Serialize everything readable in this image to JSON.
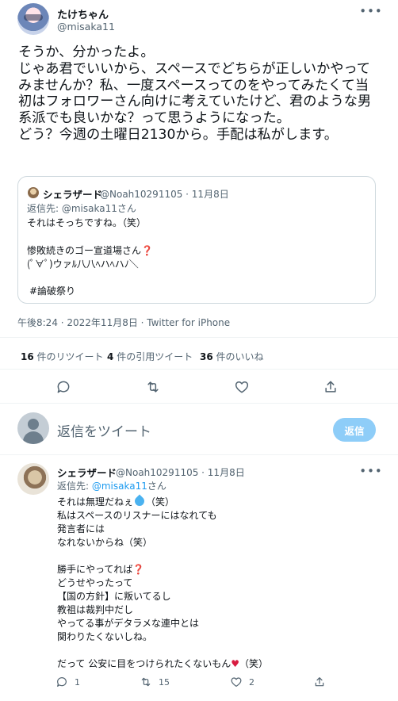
{
  "tweet": {
    "author_name": "たけちゃん",
    "author_handle": "@misaka11",
    "text": "そうか、分かったよ。\nじゃあ君でいいから、スペースでどちらが正しいかやってみませんか？私、一度スペースってのをやってみたくて当初はフォロワーさん向けに考えていたけど、君のような男系派でも良いかな？って思うようになった。\nどう？今週の土曜日2130から。手配は私がします。",
    "timestamp": "午後8:24 · 2022年11月8日 · Twitter for iPhone",
    "stats": {
      "retweets": "16",
      "retweets_label": "件のリツイート",
      "quotes": "4",
      "quotes_label": "件の引用ツイート",
      "likes": "36",
      "likes_label": "件のいいね"
    }
  },
  "quote": {
    "author_name": "シェラザード",
    "meta": "@Noah10291105 · 11月8日",
    "reply_to": "返信先: @misaka11さん",
    "line1": "それはそっちですね。（笑）",
    "line2_text": "惨敗続きのゴー宣道場さん",
    "line2_emoji": "❓",
    "line3": "(ﾟ∀ﾟ)ウァﾙ八八ﾍハﾍハﾉ＼",
    "hashtag": "#論破祭り"
  },
  "reply_box": {
    "placeholder": "返信をツイート",
    "button_label": "返信"
  },
  "reply": {
    "author_name": "シェラザード",
    "meta": "@Noah10291105 · 11月8日",
    "reply_to_prefix": "返信先: ",
    "reply_to_mention": "@misaka11",
    "reply_to_suffix": "さん",
    "line1a": "それは無理だねぇ",
    "line1b": "（笑）",
    "line2": "私はスペースのリスナーにはなれても",
    "line3": "発言者には",
    "line4": "なれないからね（笑）",
    "line5a": "勝手にやってれば",
    "line5_emoji": "❓",
    "line6": "どうせやったって",
    "line7": "【国の方針】に叛いてるし",
    "line8": "教祖は裁判中だし",
    "line9": "やってる事がデタラメな連中とは",
    "line10": "関わりたくないしね。",
    "line11a": "だって 公安に目をつけられたくないもん",
    "line11_heart": "♥",
    "line11b": "（笑）",
    "actions": {
      "replies": "1",
      "retweets": "15",
      "likes": "2"
    }
  },
  "icons": [
    "more-icon",
    "reply-icon",
    "retweet-icon",
    "like-icon",
    "share-icon"
  ]
}
